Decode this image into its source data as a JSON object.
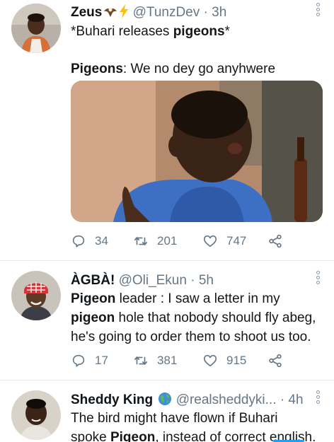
{
  "tweets": [
    {
      "name": "Zeus",
      "name_emojis": [
        "eagle-emoji",
        "lightning-emoji"
      ],
      "handle": "@TunzDev",
      "separator": "·",
      "time": "3h",
      "line1_prefix": "*Buhari releases ",
      "line1_bold": "pigeons",
      "line1_suffix": "*",
      "line2_bold": "Pigeons",
      "line2_text": ": We no dey go anyhwere",
      "media": "photo-of-child",
      "replies": "34",
      "retweets": "201",
      "likes": "747"
    },
    {
      "name": "ÀGBÀ!",
      "handle": "@Oli_Ekun",
      "separator": "·",
      "time": "5h",
      "line1_bold": "Pigeon",
      "line1_text": " leader : I saw a letter in my",
      "line2_bold": "pigeon",
      "line2_text": " hole that nobody should fly abeg,",
      "line3_text": "he's going to order them to shoot us too.",
      "replies": "17",
      "retweets": "381",
      "likes": "915"
    },
    {
      "name": "Sheddy King",
      "name_emojis": [
        "globe-emoji"
      ],
      "handle": "@realsheddyki...",
      "separator": "·",
      "time": "4h",
      "line1_text": "The bird might have flown if Buhari",
      "line2_prefix": "spoke ",
      "line2_bold": "Pigeon",
      "line2_text": ", instead of correct english."
    }
  ],
  "colors": {
    "text": "#0f1419",
    "secondary": "#657786",
    "divider": "#e1e8ed",
    "link_underline": "#1da1f2"
  }
}
